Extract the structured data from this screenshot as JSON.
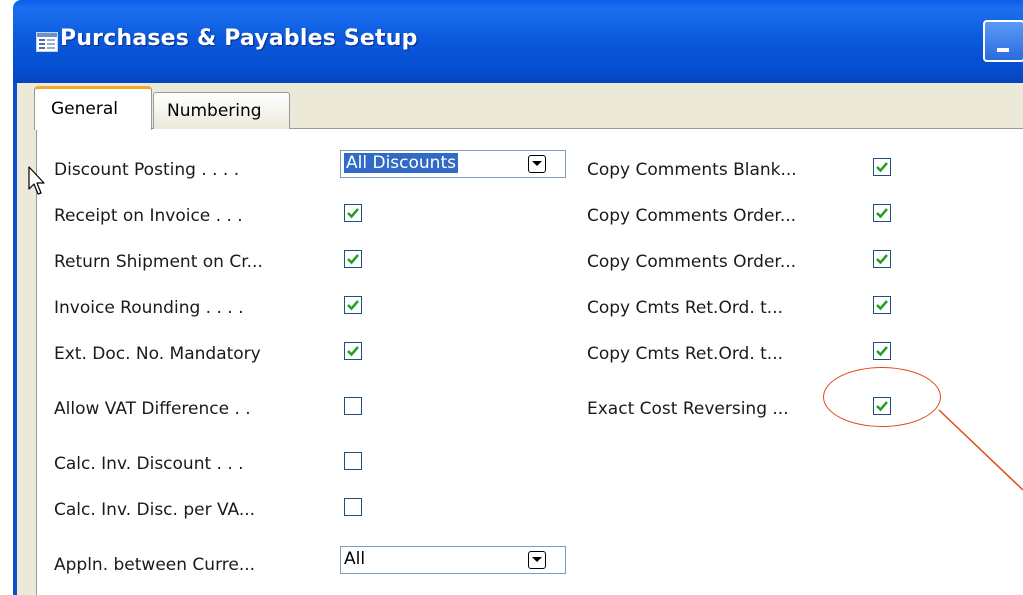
{
  "window": {
    "title": "Purchases & Payables Setup"
  },
  "tabs": [
    {
      "label": "General"
    },
    {
      "label": "Numbering"
    }
  ],
  "left_fields": {
    "discount_posting": {
      "label": "Discount Posting . . . .",
      "value": "All Discounts"
    },
    "receipt_on_invoice": {
      "label": "Receipt on Invoice . . .",
      "checked": true
    },
    "return_shipment": {
      "label": "Return Shipment on Cr...",
      "checked": true
    },
    "invoice_rounding": {
      "label": "Invoice Rounding . . . .",
      "checked": true
    },
    "ext_doc_no": {
      "label": "Ext. Doc. No. Mandatory",
      "checked": true
    },
    "allow_vat_difference": {
      "label": "Allow VAT Difference . .",
      "checked": false
    },
    "calc_inv_discount": {
      "label": "Calc. Inv. Discount . . .",
      "checked": false
    },
    "calc_inv_disc_per_vat": {
      "label": "Calc. Inv. Disc. per VA...",
      "checked": false
    },
    "appln_between_currencies": {
      "label": "Appln. between Curre...",
      "value": "All"
    }
  },
  "right_fields": {
    "copy_comments_blanket": {
      "label": "Copy Comments Blank...",
      "checked": true
    },
    "copy_comments_order_1": {
      "label": "Copy Comments Order...",
      "checked": true
    },
    "copy_comments_order_2": {
      "label": "Copy Comments Order...",
      "checked": true
    },
    "copy_cmts_ret_ord_1": {
      "label": "Copy Cmts Ret.Ord. t...",
      "checked": true
    },
    "copy_cmts_ret_ord_2": {
      "label": "Copy Cmts Ret.Ord. t...",
      "checked": true
    },
    "exact_cost_reversing": {
      "label": "Exact Cost Reversing ...",
      "checked": true
    }
  },
  "colors": {
    "titlebar": "#0a58dc",
    "dialog_bg": "#ece9d8",
    "tab_highlight": "#f6a828",
    "selection": "#316ac5",
    "checkmark": "#21a121",
    "annotation": "#e04a1a"
  },
  "icons": {
    "title": "form-icon",
    "window_button": "minimize-icon",
    "combo_button": "chevron-down-icon",
    "checkbox": "checkmark-icon",
    "pointer": "mouse-cursor-icon"
  }
}
